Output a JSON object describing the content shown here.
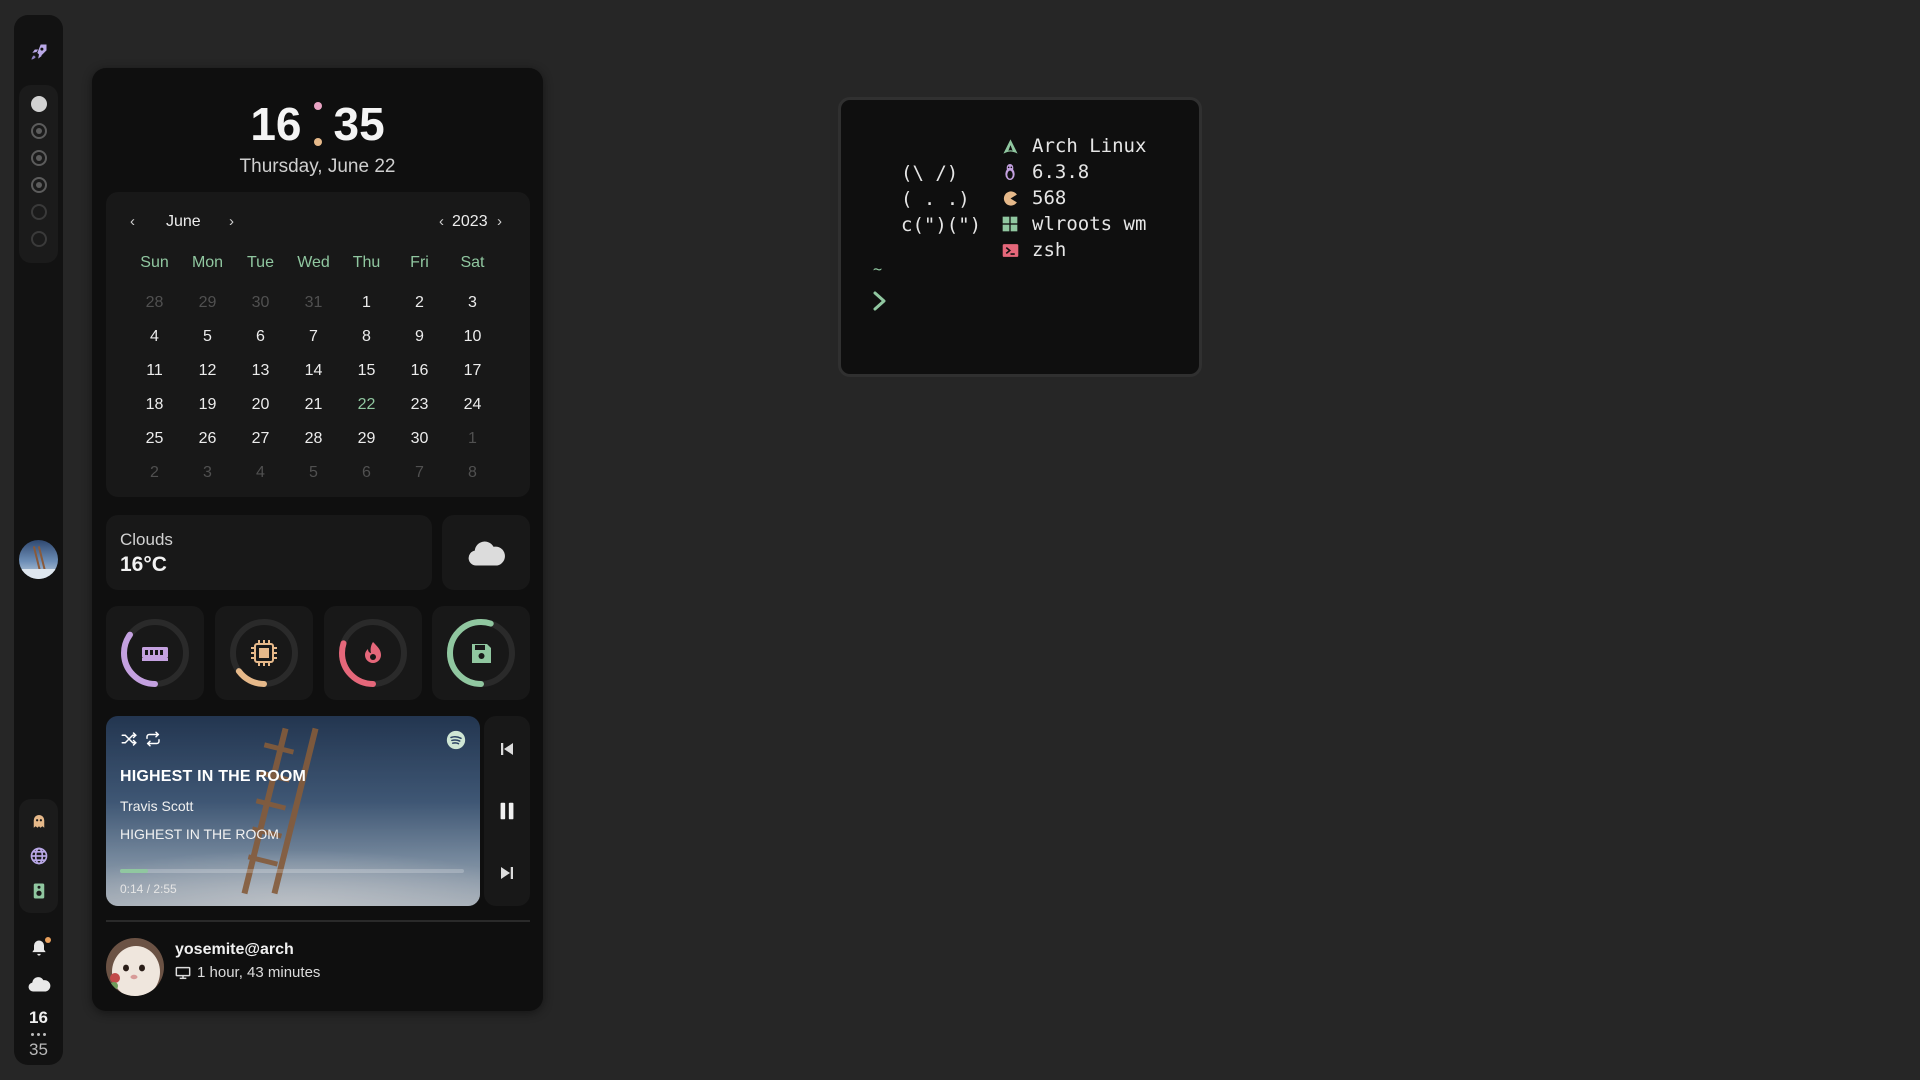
{
  "colors": {
    "accent_green": "#90c7a0",
    "accent_pink": "#e9a3c3",
    "accent_yellow": "#e6b98a",
    "accent_red": "#e5677a",
    "accent_purple": "#c4a1e0"
  },
  "bar": {
    "launcher_icon": "rocket-icon",
    "workspaces": [
      "active",
      "occupied",
      "occupied",
      "occupied",
      "empty",
      "empty"
    ],
    "tray_icons": [
      "ghost-icon",
      "globe-icon",
      "speaker-icon"
    ],
    "clock": {
      "hour": "16",
      "minute": "35"
    }
  },
  "clock": {
    "hour": "16",
    "minute": "35",
    "date": "Thursday, June 22"
  },
  "calendar": {
    "month": "June",
    "year": "2023",
    "weekdays": [
      "Sun",
      "Mon",
      "Tue",
      "Wed",
      "Thu",
      "Fri",
      "Sat"
    ],
    "weeks": [
      [
        "28",
        "29",
        "30",
        "31",
        "1",
        "2",
        "3"
      ],
      [
        "4",
        "5",
        "6",
        "7",
        "8",
        "9",
        "10"
      ],
      [
        "11",
        "12",
        "13",
        "14",
        "15",
        "16",
        "17"
      ],
      [
        "18",
        "19",
        "20",
        "21",
        "22",
        "23",
        "24"
      ],
      [
        "25",
        "26",
        "27",
        "28",
        "29",
        "30",
        "1"
      ],
      [
        "2",
        "3",
        "4",
        "5",
        "6",
        "7",
        "8"
      ]
    ],
    "today": "22"
  },
  "weather": {
    "condition": "Clouds",
    "temperature": "16°C",
    "icon": "cloud-icon"
  },
  "gauges": [
    {
      "name": "ram",
      "icon": "memory-icon",
      "level": 0.35,
      "color": "#c4a1e0"
    },
    {
      "name": "cpu",
      "icon": "cpu-icon",
      "level": 0.15,
      "color": "#e6b98a"
    },
    {
      "name": "temperature",
      "icon": "flame-icon",
      "level": 0.3,
      "color": "#e5677a"
    },
    {
      "name": "disk",
      "icon": "save-icon",
      "level": 0.55,
      "color": "#90c7a0"
    }
  ],
  "music": {
    "title": "HIGHEST IN THE ROOM",
    "artist": "Travis Scott",
    "album": "HIGHEST IN THE ROOM",
    "time": "0:14 / 2:55",
    "progress": 0.08
  },
  "user": {
    "name": "yosemite@arch",
    "uptime": "1 hour, 43 minutes"
  },
  "terminal": {
    "ascii_art": "(\\ /)\n( . .)\nc(\")(\")",
    "fetch": [
      {
        "icon": "arch-icon",
        "value": "Arch Linux",
        "color": "#90c7a0"
      },
      {
        "icon": "tux-icon",
        "value": "6.3.8",
        "color": "#c4a1e0"
      },
      {
        "icon": "pacman-icon",
        "value": "568",
        "color": "#e6b98a"
      },
      {
        "icon": "windows-grid-icon",
        "value": "wlroots wm",
        "color": "#90c7a0"
      },
      {
        "icon": "shell-icon",
        "value": "zsh",
        "color": "#e5677a"
      }
    ],
    "prompt_dir": "~"
  }
}
